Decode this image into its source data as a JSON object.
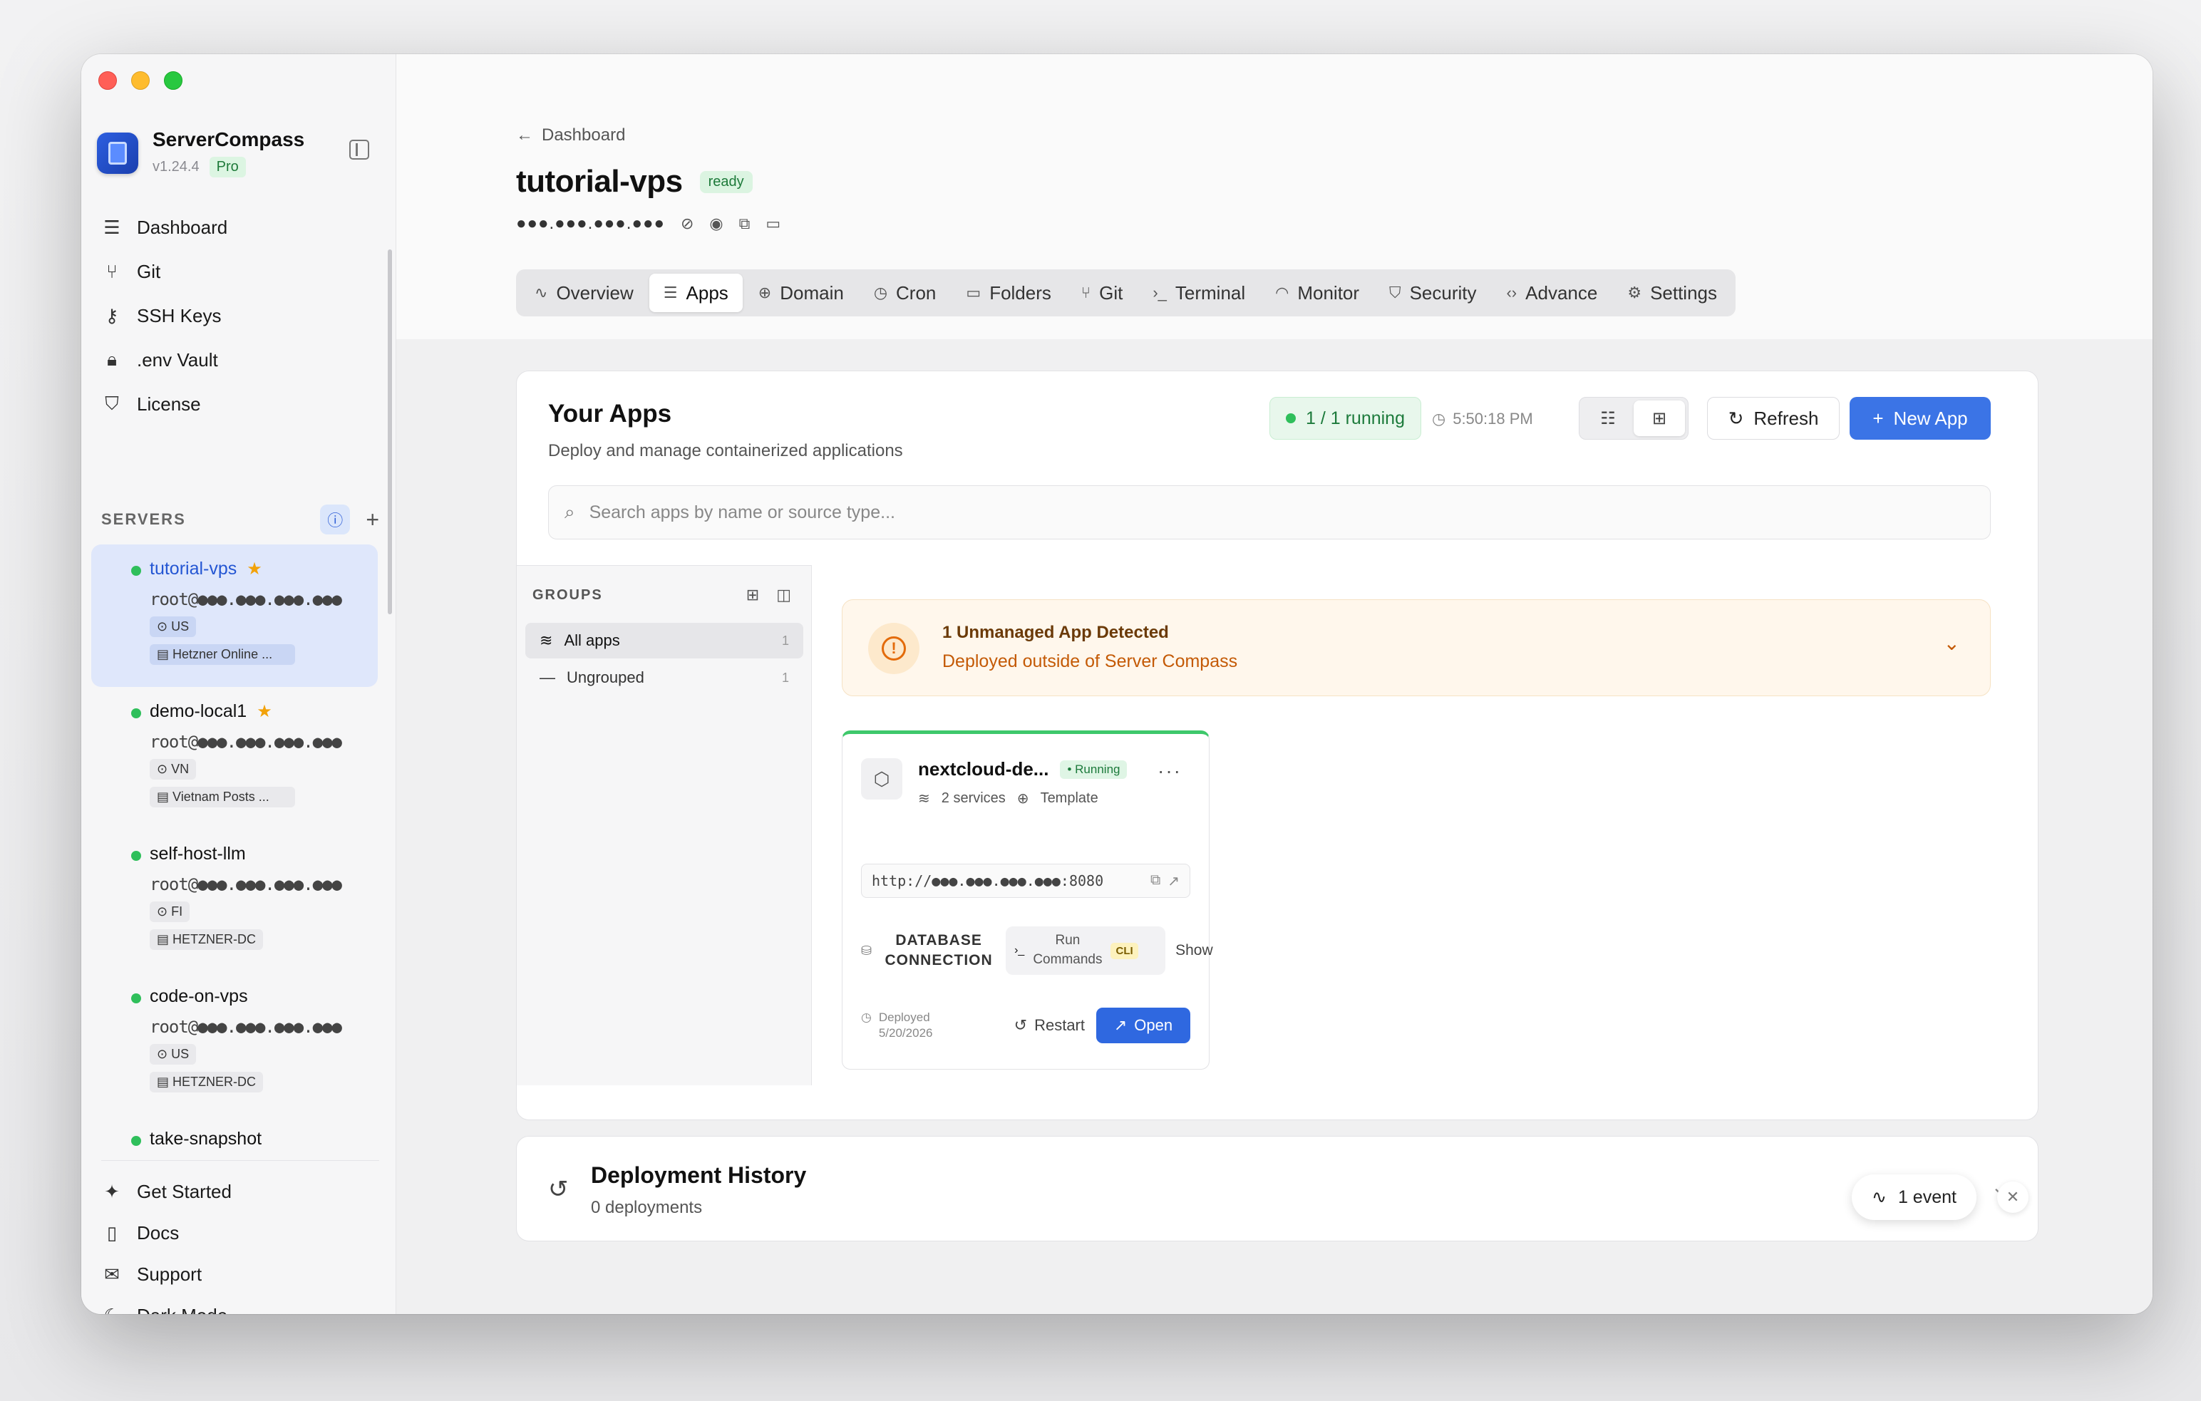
{
  "sidebar": {
    "brand": {
      "name": "ServerCompass",
      "version": "v1.24.4",
      "plan": "Pro"
    },
    "nav": [
      {
        "label": "Dashboard",
        "icon": "server-stack-icon"
      },
      {
        "label": "Git",
        "icon": "git-branch-icon"
      },
      {
        "label": "SSH Keys",
        "icon": "key-icon"
      },
      {
        "label": ".env Vault",
        "icon": "lock-icon"
      },
      {
        "label": "License",
        "icon": "shield-icon"
      }
    ],
    "servers_title": "SERVERS",
    "servers": [
      {
        "name": "tutorial-vps",
        "host": "root@●●●.●●●.●●●.●●●",
        "region": "US",
        "provider": "Hetzner Online ...",
        "starred": true,
        "active": true
      },
      {
        "name": "demo-local1",
        "host": "root@●●●.●●●.●●●.●●●",
        "region": "VN",
        "provider": "Vietnam Posts ...",
        "starred": true,
        "active": false
      },
      {
        "name": "self-host-llm",
        "host": "root@●●●.●●●.●●●.●●●",
        "region": "FI",
        "provider": "HETZNER-DC",
        "starred": false,
        "active": false
      },
      {
        "name": "code-on-vps",
        "host": "root@●●●.●●●.●●●.●●●",
        "region": "US",
        "provider": "HETZNER-DC",
        "starred": false,
        "active": false
      },
      {
        "name": "take-snapshot",
        "host": "",
        "region": "",
        "provider": "",
        "starred": false,
        "active": false
      }
    ],
    "bottom_nav": [
      {
        "label": "Get Started",
        "icon": "sparkles-icon"
      },
      {
        "label": "Docs",
        "icon": "book-icon"
      },
      {
        "label": "Support",
        "icon": "mail-icon"
      },
      {
        "label": "Dark Mode",
        "icon": "moon-icon"
      }
    ]
  },
  "header": {
    "breadcrumb": "Dashboard",
    "title": "tutorial-vps",
    "status": "ready",
    "ip_masked": "●●●.●●●.●●●.●●●"
  },
  "tabs": [
    {
      "label": "Overview",
      "icon": "activity-icon",
      "glyph": "∿"
    },
    {
      "label": "Apps",
      "icon": "server-icon",
      "glyph": "☰",
      "active": true
    },
    {
      "label": "Domain",
      "icon": "globe-icon",
      "glyph": "⊕"
    },
    {
      "label": "Cron",
      "icon": "clock-icon",
      "glyph": "◷"
    },
    {
      "label": "Folders",
      "icon": "folder-icon",
      "glyph": "▭"
    },
    {
      "label": "Git",
      "icon": "git-branch-icon",
      "glyph": "⑂"
    },
    {
      "label": "Terminal",
      "icon": "terminal-icon",
      "glyph": "›_"
    },
    {
      "label": "Monitor",
      "icon": "gauge-icon",
      "glyph": "◠"
    },
    {
      "label": "Security",
      "icon": "shield-icon",
      "glyph": "⛉"
    },
    {
      "label": "Advance",
      "icon": "code-icon",
      "glyph": "‹›"
    },
    {
      "label": "Settings",
      "icon": "gear-icon",
      "glyph": "⚙"
    }
  ],
  "apps": {
    "title": "Your Apps",
    "subtitle": "Deploy and manage containerized applications",
    "running": "1 / 1 running",
    "time": "5:50:18 PM",
    "refresh_label": "Refresh",
    "new_app_label": "New App",
    "search_placeholder": "Search apps by name or source type..."
  },
  "groups": {
    "title": "GROUPS",
    "items": [
      {
        "label": "All apps",
        "count": "1",
        "active": true
      },
      {
        "label": "Ungrouped",
        "count": "1",
        "active": false
      }
    ]
  },
  "unmanaged": {
    "title": "1 Unmanaged App Detected",
    "subtitle": "Deployed outside of Server Compass"
  },
  "app_card": {
    "name": "nextcloud-de...",
    "status": "Running",
    "services": "2 services",
    "source": "Template",
    "url": "http://●●●.●●●.●●●.●●●:8080",
    "db_label_1": "DATABASE",
    "db_label_2": "CONNECTION",
    "run_1": "Run",
    "run_2": "Commands",
    "cli": "CLI",
    "show": "Show",
    "deployed_1": "Deployed",
    "deployed_2": "5/20/2026",
    "restart": "Restart",
    "open": "Open"
  },
  "history": {
    "title": "Deployment History",
    "subtitle": "0 deployments"
  },
  "event": {
    "label": "1 event"
  },
  "colors": {
    "accent": "#3b74e6",
    "success": "#2fbf5b",
    "warning": "#e36b0a",
    "star": "#f2a20a"
  }
}
